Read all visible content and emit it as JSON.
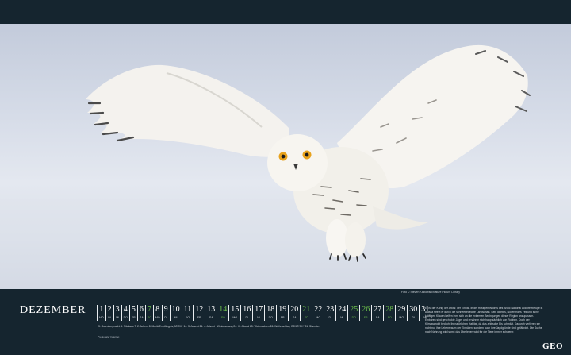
{
  "photo": {
    "subject": "snowy-owl",
    "credit": "Foto © Steven Kazlowski/Nature Picture Library"
  },
  "calendar": {
    "month": "DEZEMBER",
    "days": [
      {
        "num": "1",
        "wd": "MO"
      },
      {
        "num": "2",
        "wd": "DI"
      },
      {
        "num": "3",
        "wd": "MI"
      },
      {
        "num": "4",
        "wd": "DO"
      },
      {
        "num": "5",
        "wd": "FR"
      },
      {
        "num": "6",
        "wd": "SA"
      },
      {
        "num": "7",
        "wd": "SO",
        "sunday": true
      },
      {
        "num": "8",
        "wd": "MO"
      },
      {
        "num": "9",
        "wd": "DI"
      },
      {
        "num": "10",
        "wd": "MI"
      },
      {
        "num": "11",
        "wd": "DO"
      },
      {
        "num": "12",
        "wd": "FR"
      },
      {
        "num": "13",
        "wd": "SA"
      },
      {
        "num": "14",
        "wd": "SO",
        "sunday": true
      },
      {
        "num": "15",
        "wd": "MO"
      },
      {
        "num": "16",
        "wd": "DI"
      },
      {
        "num": "17",
        "wd": "MI"
      },
      {
        "num": "18",
        "wd": "DO"
      },
      {
        "num": "19",
        "wd": "FR"
      },
      {
        "num": "20",
        "wd": "SA"
      },
      {
        "num": "21",
        "wd": "SO",
        "sunday": true
      },
      {
        "num": "22",
        "wd": "MO"
      },
      {
        "num": "23",
        "wd": "DI"
      },
      {
        "num": "24",
        "wd": "MI"
      },
      {
        "num": "25",
        "wd": "DO",
        "holiday": true
      },
      {
        "num": "26",
        "wd": "FR",
        "holiday": true
      },
      {
        "num": "27",
        "wd": "SA"
      },
      {
        "num": "28",
        "wd": "SO",
        "sunday": true
      },
      {
        "num": "29",
        "wd": "MO"
      },
      {
        "num": "30",
        "wd": "DI"
      },
      {
        "num": "31",
        "wd": "MI"
      }
    ],
    "holidays": "3. Gutenbergnacht   6. Nikolaus   7. 2. Advent   8. Mariä Empfängnis, AT/CH*   14. 3. Advent   21. 4. Advent · Winteranfang   24. Hl. Abend   25. Weihnachten   26. Weihnachten, DE/AT/CH*   31. Silvester",
    "footnote": "*regionaler Feiertag"
  },
  "description": "Er ist der König der Arktis: der Einbär. In der frostigen Wildnis des Arctic National Wildlife Refuge in Alaska streift er durch die schneebedeckte Landschaft. Sein dichtes, isolierendes Fell und seine kräftigen Klauen helfen ihm, sich an die extremen Bedingungen dieser Region anzupassen. Einbären sind geschickte Jäger und ernähren sich hauptsächlich von Robben. Doch der Klimawandel bedroht ihr natürlichen Habitat, da das arktische Eis schmilzt. Dadurch verlieren sie nicht nur ihre Lebensraum der Einbären, sondern auch ihre Jagdgründe sind gefährdet. Die Suche nach Nahrung wird somit das Überleben wird für die Tiere immer schwerer.",
  "brand": {
    "logo": "GEO"
  }
}
